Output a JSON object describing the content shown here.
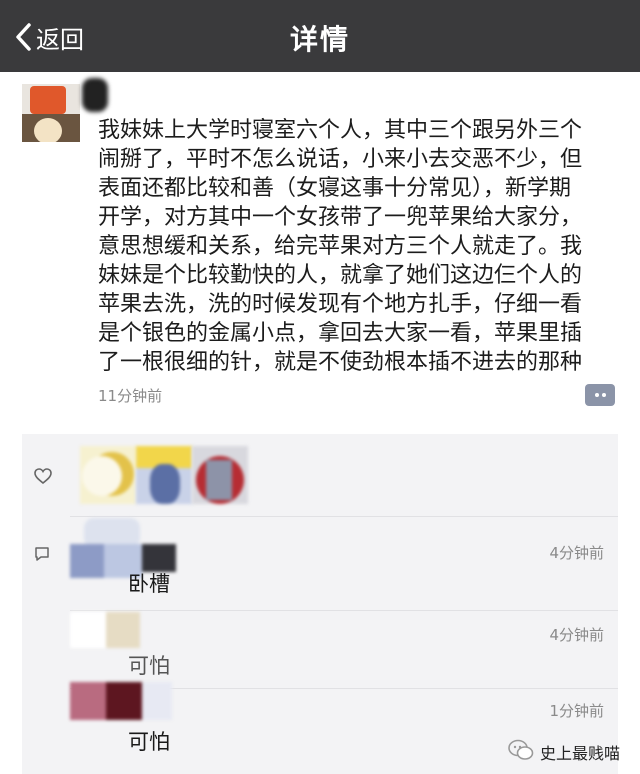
{
  "header": {
    "back_label": "返回",
    "title": "详情",
    "background": "#3a3a3c"
  },
  "post": {
    "text_lines": [
      "我妹妹上大学时寝室六个人，其中三个跟另外三个",
      "闹掰了，平时不怎么说话，小来小去交恶不少，但",
      "表面还都比较和善（女寝这事十分常见），新学期",
      "开学，对方其中一个女孩带了一兜苹果给大家分，",
      "意思想缓和关系，给完苹果对方三个人就走了。我",
      "妹妹是个比较勤快的人，就拿了她们这边仨个人的",
      "苹果去洗，洗的时候发现有个地方扎手，仔细一看",
      "是个银色的金属小点，拿回去大家一看，苹果里插",
      "了一根很细的针，就是不使劲根本插不进去的那种"
    ],
    "time": "11分钟前"
  },
  "icons": {
    "back": "chevron-left-icon",
    "comment_button": "comment-bubble-icon",
    "like": "heart-icon",
    "comment": "comment-icon",
    "watermark": "wechat-icon"
  },
  "comments": [
    {
      "text": "卧槽",
      "time": "4分钟前"
    },
    {
      "text": "可怕",
      "time": "4分钟前"
    },
    {
      "text": "可怕",
      "time": "1分钟前"
    }
  ],
  "watermark": {
    "text": "史上最贱喵"
  },
  "colors": {
    "panel_background": "#f3f3f5",
    "timestamp": "#8a8a8a",
    "comment_button": "#8b94a8"
  }
}
